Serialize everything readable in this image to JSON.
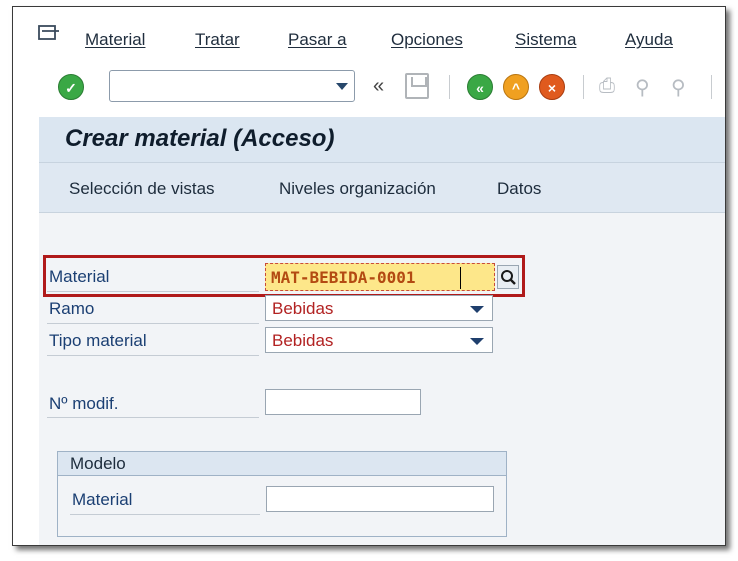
{
  "menu": {
    "items": [
      "Material",
      "Tratar",
      "Pasar a",
      "Opciones",
      "Sistema",
      "Ayuda"
    ]
  },
  "toolbar": {
    "command_value": ""
  },
  "screen": {
    "title": "Crear material (Acceso)",
    "app_buttons": [
      "Selección de vistas",
      "Niveles organización",
      "Datos"
    ]
  },
  "form": {
    "material_label": "Material",
    "material_value": "MAT-BEBIDA-0001",
    "ramo_label": "Ramo",
    "ramo_value": "Bebidas",
    "tipo_label": "Tipo material",
    "tipo_value": "Bebidas",
    "modif_label": "Nº modif.",
    "modif_value": ""
  },
  "modelo": {
    "title": "Modelo",
    "material_label": "Material",
    "material_value": ""
  },
  "colors": {
    "highlight": "#b01a1a",
    "field_focus": "#fde78a",
    "value_text": "#b22222",
    "label_text": "#1b3f73"
  }
}
